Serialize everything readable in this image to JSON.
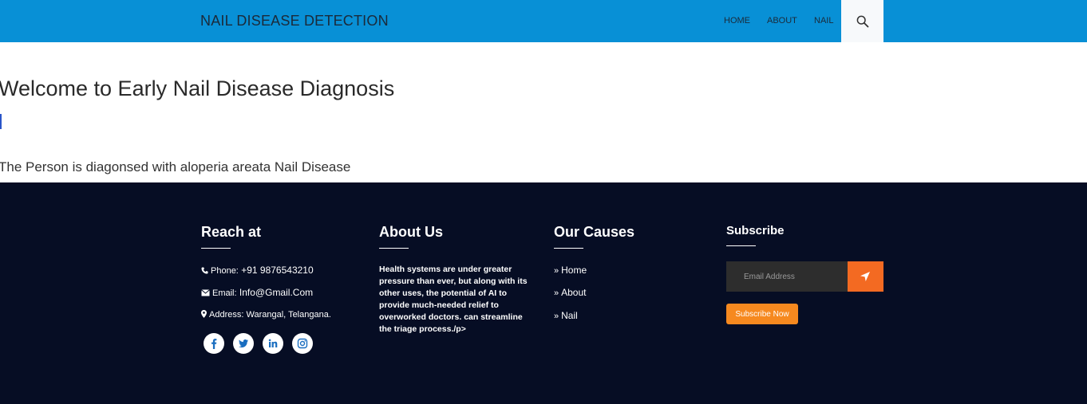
{
  "header": {
    "brand": "NAIL DISEASE DETECTION",
    "nav": [
      {
        "label": "HOME"
      },
      {
        "label": "ABOUT"
      },
      {
        "label": "NAIL"
      }
    ],
    "search_icon": "search-icon"
  },
  "main": {
    "title": "Welcome to Early Nail Disease Diagnosis",
    "result": "The Person is diagonsed with aloperia areata Nail Disease"
  },
  "footer": {
    "reach": {
      "heading": "Reach at",
      "phone_label": "Phone:",
      "phone_value": "+91 9876543210",
      "email_label": "Email:",
      "email_value": "Info@Gmail.Com",
      "address_label": "Address:",
      "address_value": "Warangal, Telangana.",
      "social": [
        "facebook-icon",
        "twitter-icon",
        "linkedin-icon",
        "instagram-icon"
      ]
    },
    "about": {
      "heading": "About Us",
      "text": "Health systems are under greater pressure than ever, but along with its other uses, the potential of AI to provide much-needed relief to overworked doctors. can streamline the triage process./p>"
    },
    "causes": {
      "heading": "Our Causes",
      "links": [
        "Home",
        "About",
        "Nail"
      ]
    },
    "subscribe": {
      "heading": "Subscribe",
      "email_placeholder": "Email Address",
      "button_label": "Subscribe Now"
    }
  },
  "colors": {
    "header_bg": "#0890d6",
    "footer_bg": "#060d24",
    "send_button": "#f36a22",
    "subscribe_button": "#f6891f"
  }
}
